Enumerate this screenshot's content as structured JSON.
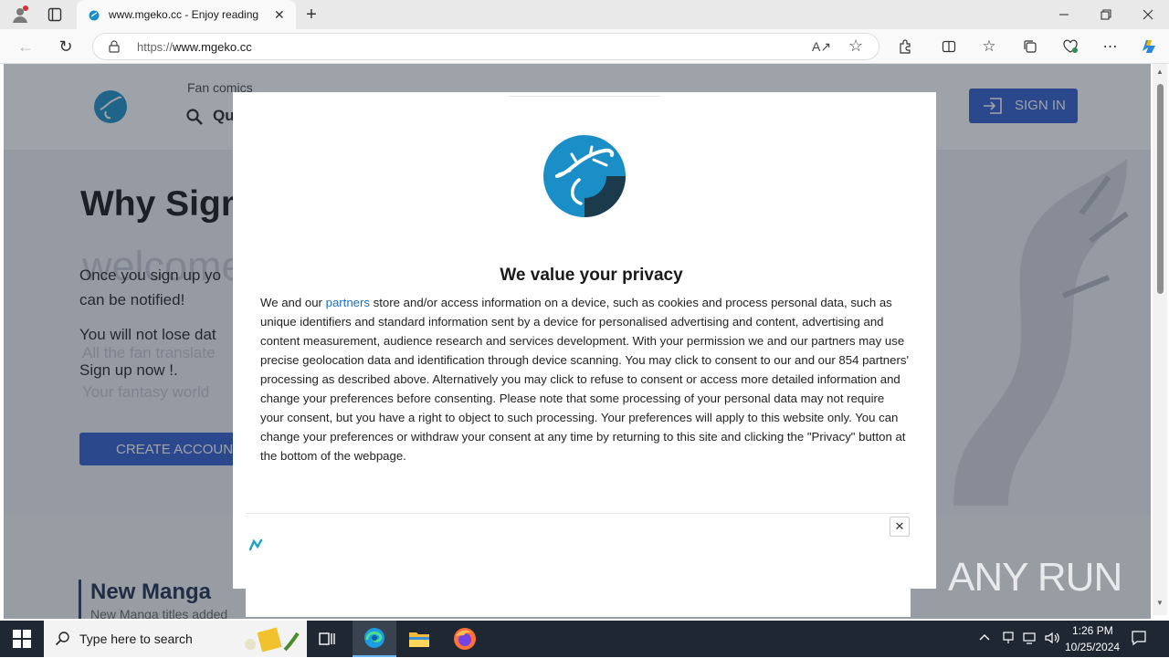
{
  "browser": {
    "tab_title": "www.mgeko.cc - Enjoy reading",
    "url_prefix": "https://",
    "url_host": "www.mgeko.cc"
  },
  "site": {
    "nav_label": "Fan comics",
    "search_label": "Qu",
    "signin_label": "SIGN IN",
    "hero": {
      "heading": "Why Sign",
      "line1": "Once you sign up yo",
      "line1b": "can be notified!",
      "line2": "You will not lose dat",
      "line3": "Sign up now !.",
      "ghost1": "welcome",
      "ghost2": "All the fan translate",
      "ghost3": "Your fantasy world",
      "cta_label": "CREATE ACCOUN"
    },
    "section": {
      "title": "New Manga",
      "subtitle": "New Manga titles added"
    }
  },
  "consent": {
    "title": "We value your privacy",
    "body_prefix": "We and our ",
    "partners_link": "partners",
    "body": " store and/or access information on a device, such as cookies and process personal data, such as unique identifiers and standard information sent by a device for personalised advertising and content, advertising and content measurement, audience research and services development. With your permission we and our partners may use precise geolocation data and identification through device scanning. You may click to consent to our and our 854 partners' processing as described above. Alternatively you may click to refuse to consent or access more detailed information and change your preferences before consenting. Please note that some processing of your personal data may not require your consent, but you have a right to object to such processing. Your preferences will apply to this website only. You can change your preferences or withdraw your consent at any time by returning to this site and clicking the \"Privacy\" button at the bottom of the webpage."
  },
  "watermark": "ANY RUN",
  "taskbar": {
    "search_placeholder": "Type here to search",
    "time": "1:26 PM",
    "date": "10/25/2024"
  },
  "colors": {
    "accent": "#1a6fc2",
    "logo_blue": "#1a8fc7",
    "signin_bg": "#2f5bcc",
    "taskbar": "#1f2733"
  },
  "icons": [
    "profile-icon",
    "tab-actions-icon",
    "site-favicon",
    "close-tab-icon",
    "new-tab-icon",
    "minimize-icon",
    "restore-icon",
    "close-window-icon",
    "back-icon",
    "refresh-icon",
    "lock-icon",
    "read-aloud-icon",
    "favorite-star-icon",
    "extensions-icon",
    "split-screen-icon",
    "favorites-icon",
    "collections-icon",
    "browser-essentials-icon",
    "more-icon",
    "copilot-icon",
    "search-icon",
    "signin-icon",
    "gecko-logo",
    "ad-close-icon",
    "ad-choices-icon",
    "windows-start-icon",
    "task-view-icon",
    "edge-icon",
    "file-explorer-icon",
    "firefox-icon",
    "notification-icon"
  ]
}
